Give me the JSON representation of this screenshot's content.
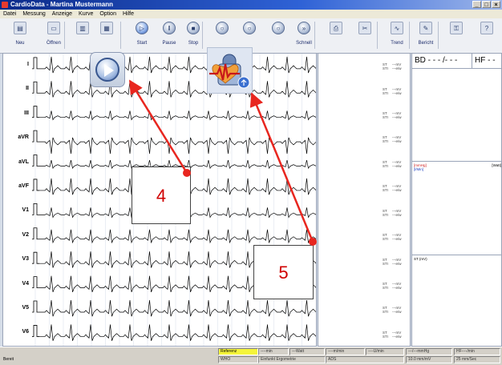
{
  "window": {
    "title": "CardioData - Martina Mustermann"
  },
  "menu": [
    "Datei",
    "Messung",
    "Anzeige",
    "Kurve",
    "Option",
    "Hilfe"
  ],
  "toolbar": [
    {
      "id": "new",
      "label": "Neu",
      "icon": "new-file-icon"
    },
    {
      "id": "open",
      "label": "Öffnen",
      "icon": "open-folder-icon"
    },
    {
      "id": "t3",
      "label": "",
      "icon": "clipboard-icon"
    },
    {
      "id": "t4",
      "label": "",
      "icon": "settings-panel-icon"
    },
    {
      "id": "start",
      "label": "Start",
      "icon": "play-icon"
    },
    {
      "id": "pause",
      "label": "Pause",
      "icon": "pause-icon"
    },
    {
      "id": "stop",
      "label": "Stop",
      "icon": "stop-icon"
    },
    {
      "id": "b1",
      "label": "",
      "icon": "round-button-icon"
    },
    {
      "id": "b2",
      "label": "",
      "icon": "round-button-icon"
    },
    {
      "id": "b3",
      "label": "",
      "icon": "round-button-icon"
    },
    {
      "id": "fast",
      "label": "Schnell",
      "icon": "fast-icon"
    },
    {
      "id": "print",
      "label": "",
      "icon": "print-icon"
    },
    {
      "id": "scissors",
      "label": "",
      "icon": "cut-icon"
    },
    {
      "id": "trend",
      "label": "Trend",
      "icon": "trend-icon"
    },
    {
      "id": "report",
      "label": "Bericht",
      "icon": "report-icon"
    },
    {
      "id": "lock",
      "label": "",
      "icon": "lock-icon"
    },
    {
      "id": "help",
      "label": "",
      "icon": "help-icon"
    }
  ],
  "leads": [
    "I",
    "II",
    "III",
    "aVR",
    "aVL",
    "aVF",
    "V1",
    "V2",
    "V3",
    "V4",
    "V5",
    "V6"
  ],
  "measure_labels": {
    "st": "ST",
    "mv": "---mV",
    "st2": "STI",
    "evw": "---e/w"
  },
  "right_panel": {
    "bd": "BD - - - /- - -",
    "hf": "HF - -",
    "panel2_label_red": "[mmHg]",
    "panel2_label_blue": "[l/Min]",
    "panel2_right": "[Watt]",
    "panel3_label": "ST (mV)"
  },
  "status": {
    "ready": "Bereit",
    "referenz": "Referenz",
    "min": "----min",
    "watt": "---Watt",
    "mmin": "----m/min",
    "umin": "----U/min",
    "mmhg": "---/---mmHg",
    "hf": "HF----/min",
    "who": "WHO",
    "ergometrie": "Einfunkt Ergometrie",
    "ads": "ADS",
    "sens": "10.0 mm/mV",
    "speed": "25 mm/Sec"
  },
  "callouts": {
    "four": "4",
    "five": "5"
  },
  "colors": {
    "accent": "#e8261f",
    "title": "#0b2b8a",
    "referenz": "#f4f43a"
  }
}
